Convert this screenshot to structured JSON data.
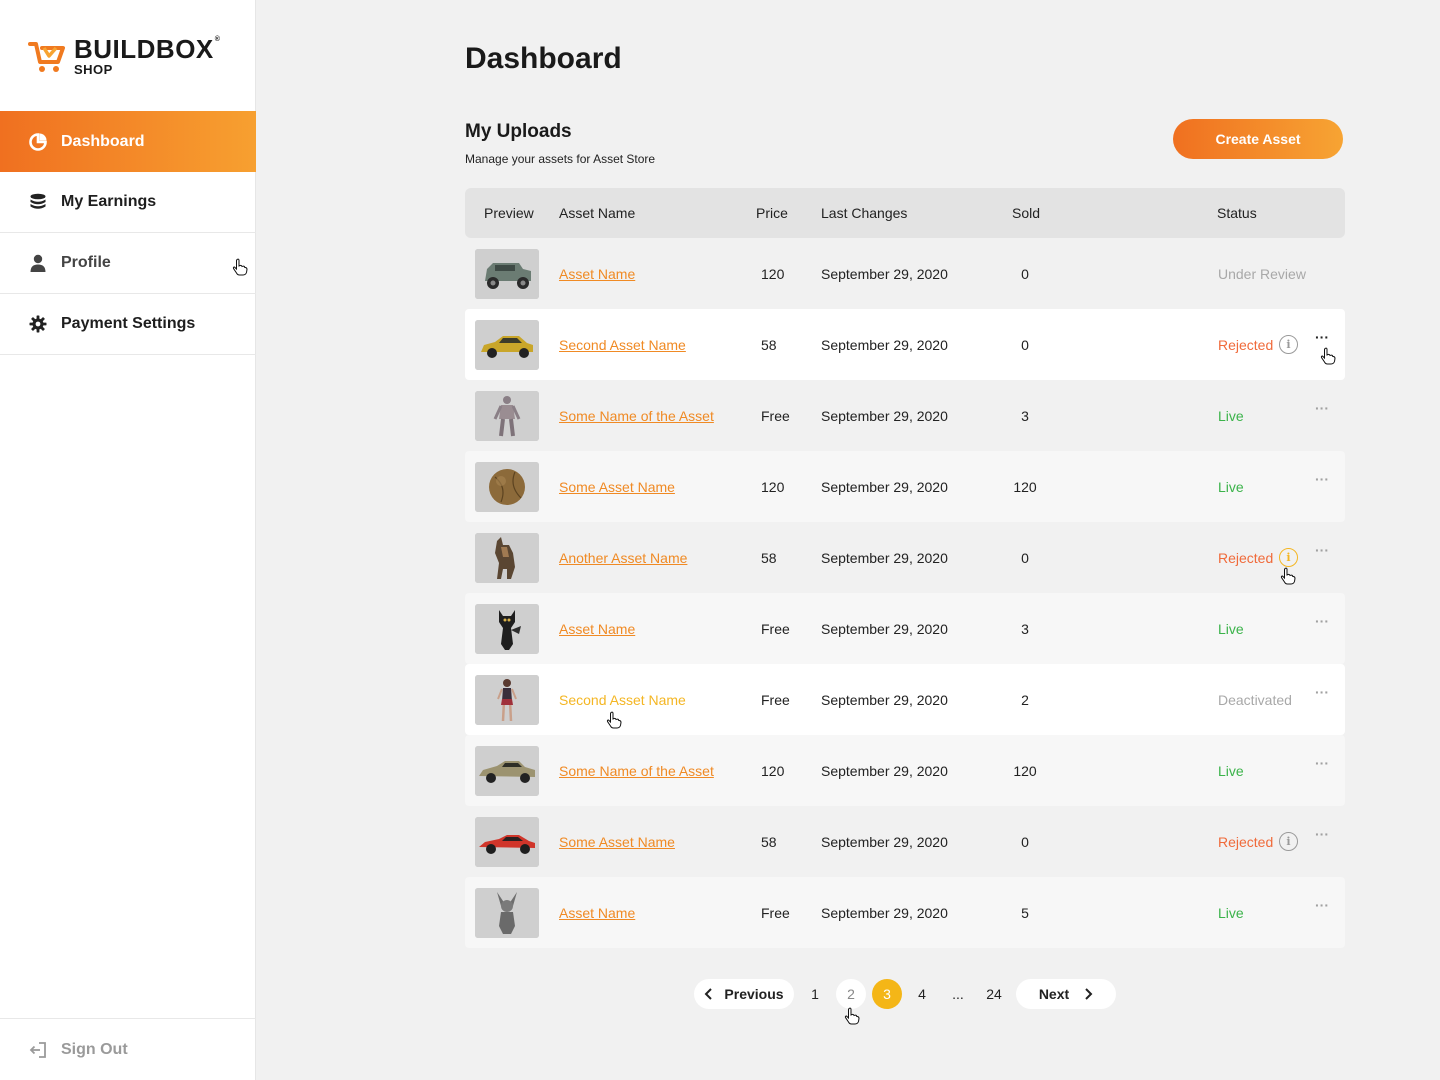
{
  "brand": {
    "name": "BUILDBOX",
    "sub": "SHOP"
  },
  "sidebar": {
    "items": [
      {
        "label": "Dashboard",
        "icon": "dashboard-pie-icon"
      },
      {
        "label": "My Earnings",
        "icon": "coins-stack-icon"
      },
      {
        "label": "Profile",
        "icon": "user-icon"
      },
      {
        "label": "Payment Settings",
        "icon": "gear-icon"
      }
    ],
    "signout": "Sign Out"
  },
  "header": {
    "title": "Dashboard"
  },
  "uploads": {
    "title": "My Uploads",
    "subtitle": "Manage your assets for Asset Store",
    "create_label": "Create Asset"
  },
  "table": {
    "columns": [
      "Preview",
      "Asset Name",
      "Price",
      "Last Changes",
      "Sold",
      "Status"
    ],
    "rows": [
      {
        "preview": "jeep",
        "name": "Asset Name",
        "price": "120",
        "date": "September 29, 2020",
        "sold": "0",
        "status": "Under Review"
      },
      {
        "preview": "yellow-car",
        "name": "Second Asset Name",
        "price": "58",
        "date": "September 29, 2020",
        "sold": "0",
        "status": "Rejected"
      },
      {
        "preview": "robot",
        "name": "Some Name of the Asset",
        "price": "Free",
        "date": "September 29, 2020",
        "sold": "3",
        "status": "Live"
      },
      {
        "preview": "ball",
        "name": "Some Asset Name",
        "price": "120",
        "date": "September 29, 2020",
        "sold": "120",
        "status": "Live"
      },
      {
        "preview": "dog",
        "name": "Another Asset Name",
        "price": "58",
        "date": "September 29, 2020",
        "sold": "0",
        "status": "Rejected"
      },
      {
        "preview": "cat",
        "name": "Asset Name",
        "price": "Free",
        "date": "September 29, 2020",
        "sold": "3",
        "status": "Live"
      },
      {
        "preview": "girl",
        "name": "Second Asset Name",
        "price": "Free",
        "date": "September 29, 2020",
        "sold": "2",
        "status": "Deactivated"
      },
      {
        "preview": "muscle-car",
        "name": "Some Name of the Asset",
        "price": "120",
        "date": "September 29, 2020",
        "sold": "120",
        "status": "Live"
      },
      {
        "preview": "red-sports-car",
        "name": "Some Asset Name",
        "price": "58",
        "date": "September 29, 2020",
        "sold": "0",
        "status": "Rejected"
      },
      {
        "preview": "bunny",
        "name": "Asset Name",
        "price": "Free",
        "date": "September 29, 2020",
        "sold": "5",
        "status": "Live"
      }
    ]
  },
  "pagination": {
    "previous": "Previous",
    "next": "Next",
    "pages": [
      "1",
      "2",
      "3",
      "4",
      "...",
      "24"
    ],
    "current": "3"
  },
  "colors": {
    "accent": "#f07020",
    "accent_light": "#f7a433",
    "current_page": "#f4b617",
    "live": "#3bb34a",
    "rejected": "#f06a3a"
  }
}
